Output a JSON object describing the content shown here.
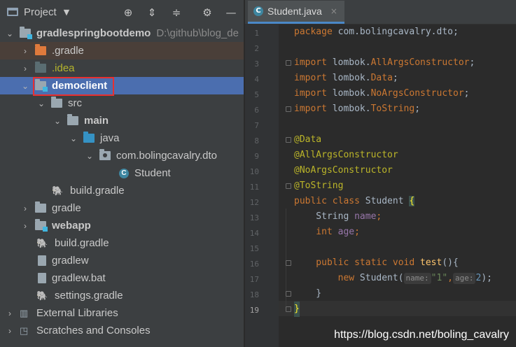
{
  "project": {
    "title": "Project",
    "tree": [
      {
        "label": "gradlespringbootdemo",
        "path": "D:\\github\\blog_de"
      },
      {
        "label": ".gradle"
      },
      {
        "label": ".idea"
      },
      {
        "label": "democlient"
      },
      {
        "label": "src"
      },
      {
        "label": "main"
      },
      {
        "label": "java"
      },
      {
        "label": "com.bolingcavalry.dto"
      },
      {
        "label": "Student"
      },
      {
        "label": "build.gradle"
      },
      {
        "label": "gradle"
      },
      {
        "label": "webapp"
      },
      {
        "label": "build.gradle"
      },
      {
        "label": "gradlew"
      },
      {
        "label": "gradlew.bat"
      },
      {
        "label": "settings.gradle"
      },
      {
        "label": "External Libraries"
      },
      {
        "label": "Scratches and Consoles"
      }
    ]
  },
  "editor": {
    "tab": {
      "label": "Student.java",
      "close": "×"
    },
    "line_numbers": [
      "1",
      "2",
      "3",
      "4",
      "5",
      "6",
      "7",
      "8",
      "9",
      "10",
      "11",
      "12",
      "13",
      "14",
      "15",
      "16",
      "17",
      "18",
      "19"
    ],
    "code": {
      "l1_kw": "package",
      "l1_rest": " com.bolingcavalry.dto;",
      "l3_kw": "import",
      "l3_a": " lombok.",
      "l3_b": "AllArgsConstructor",
      "l3_c": ";",
      "l4_kw": "import",
      "l4_a": " lombok.",
      "l4_b": "Data",
      "l4_c": ";",
      "l5_kw": "import",
      "l5_a": " lombok.",
      "l5_b": "NoArgsConstructor",
      "l5_c": ";",
      "l6_kw": "import",
      "l6_a": " lombok.",
      "l6_b": "ToString",
      "l6_c": ";",
      "l8": "@Data",
      "l9": "@AllArgsConstructor",
      "l10": "@NoArgsConstructor",
      "l11": "@ToString",
      "l12_kw": "public class",
      "l12_name": " Student ",
      "l12_brace": "{",
      "l13_type": "    String ",
      "l13_field": "name",
      "l13_end": ";",
      "l14_kw": "    int ",
      "l14_field": "age",
      "l14_end": ";",
      "l16_kw": "    public static void ",
      "l16_m": "test",
      "l16_end": "(){",
      "l17_kw": "        new",
      "l17_cls": " Student(",
      "l17_h1": "name:",
      "l17_s": "\"1\"",
      "l17_comma": ",",
      "l17_h2": "age:",
      "l17_n": "2",
      "l17_end": ");",
      "l18": "    }",
      "l19": "}"
    }
  },
  "watermark": "https://blog.csdn.net/boling_cavalry"
}
